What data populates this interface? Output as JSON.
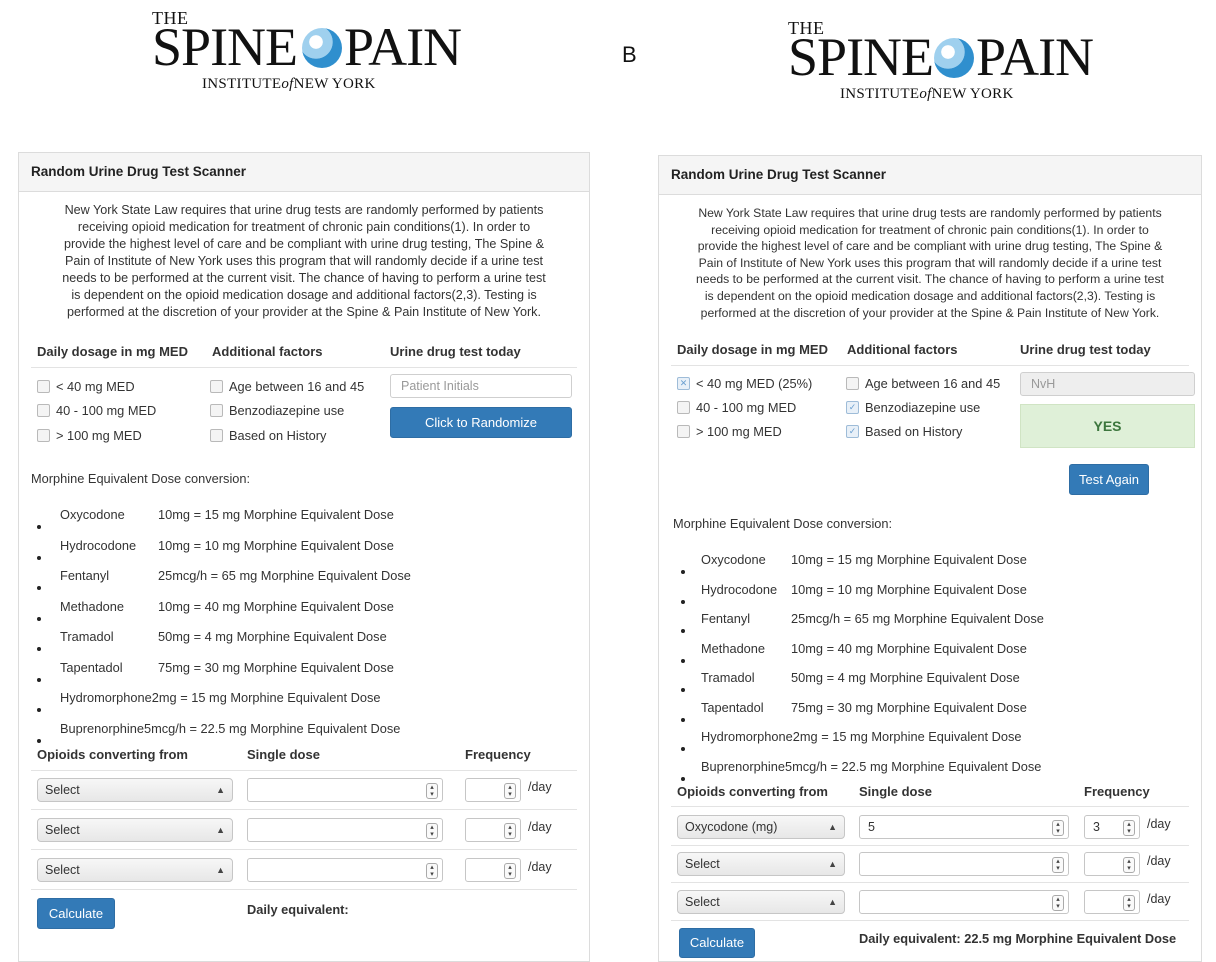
{
  "logo": {
    "the": "THE",
    "spine": "SPINE",
    "pain": "PAIN",
    "institute": "INSTITUTE",
    "of": "of",
    "new_york": "NEW YORK"
  },
  "section_label": "B",
  "panel_title": "Random Urine Drug Test Scanner",
  "intro_lines": [
    "New York State Law requires that urine drug tests are randomly performed by patients",
    "receiving opioid medication for treatment of chronic pain conditions(1). In order to",
    "provide the highest level of care and be compliant with urine drug testing, The Spine &",
    "Pain of Institute of New York uses this program that will randomly decide if a urine test",
    "needs to be performed at the current visit. The chance of having to perform a urine test",
    "is dependent on the opioid medication dosage and additional factors(2,3). Testing is",
    "performed at the discretion of your provider at the Spine & Pain Institute of New York."
  ],
  "headers": {
    "daily_dosage": "Daily dosage in mg MED",
    "additional_factors": "Additional factors",
    "urine_test_today": "Urine drug test today"
  },
  "left": {
    "dosage_options": [
      "< 40 mg MED",
      "40 - 100 mg MED",
      "> 100 mg MED"
    ],
    "factor_options": [
      "Age between 16 and 45",
      "Benzodiazepine use",
      "Based on History"
    ],
    "initials_placeholder": "Patient Initials",
    "randomize_button": "Click to Randomize",
    "selects": [
      "Select",
      "Select",
      "Select"
    ],
    "doses": [
      "",
      "",
      ""
    ],
    "freqs": [
      "",
      "",
      ""
    ],
    "daily_equivalent": "Daily equivalent:"
  },
  "right": {
    "dosage_options": [
      "< 40 mg MED (25%)",
      "40 - 100 mg MED",
      "> 100 mg MED"
    ],
    "dosage_checked": [
      true,
      false,
      false
    ],
    "factor_options": [
      "Age between 16 and 45",
      "Benzodiazepine use",
      "Based on History"
    ],
    "factor_checked": [
      false,
      true,
      true
    ],
    "initials_value": "NvH",
    "result": "YES",
    "test_again_button": "Test Again",
    "selects": [
      "Oxycodone (mg)",
      "Select",
      "Select"
    ],
    "doses": [
      "5",
      "",
      ""
    ],
    "freqs": [
      "3",
      "",
      ""
    ],
    "daily_equivalent": "Daily equivalent: 22.5 mg Morphine Equivalent Dose"
  },
  "med_title": "Morphine Equivalent Dose conversion:",
  "meds": [
    {
      "name": "Oxycodone",
      "conv": "10mg = 15 mg Morphine Equivalent Dose"
    },
    {
      "name": "Hydrocodone",
      "conv": "10mg = 10 mg Morphine Equivalent Dose"
    },
    {
      "name": "Fentanyl",
      "conv": "25mcg/h = 65 mg Morphine Equivalent Dose"
    },
    {
      "name": "Methadone",
      "conv": "10mg = 40 mg Morphine Equivalent Dose"
    },
    {
      "name": "Tramadol",
      "conv": "50mg = 4 mg Morphine Equivalent Dose"
    },
    {
      "name": "Tapentadol",
      "conv": "75mg = 30 mg Morphine Equivalent Dose"
    },
    {
      "name": "Hydromorphone",
      "conv": "2mg = 15 mg Morphine Equivalent Dose"
    },
    {
      "name": "Buprenorphine",
      "conv": "5mcg/h = 22.5 mg Morphine Equivalent Dose"
    }
  ],
  "calc_headers": {
    "opioids": "Opioids converting from",
    "single_dose": "Single dose",
    "frequency": "Frequency",
    "per_day": "/day"
  },
  "calculate_button": "Calculate"
}
